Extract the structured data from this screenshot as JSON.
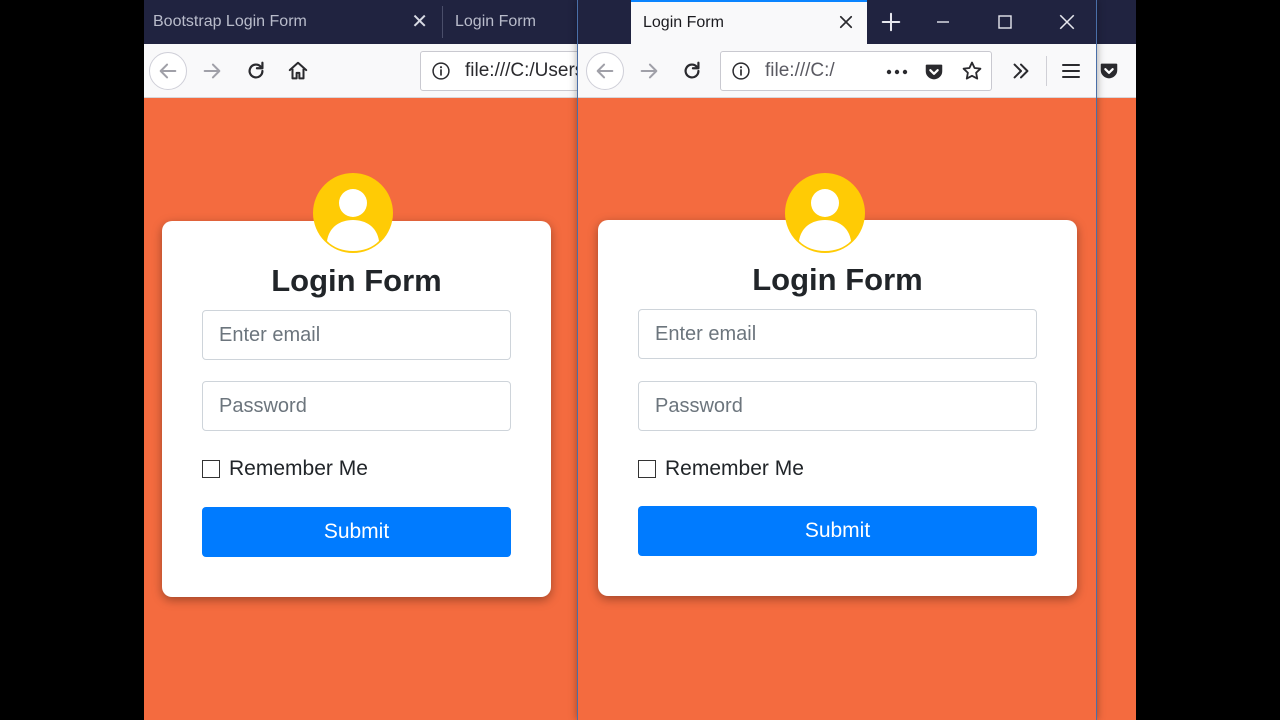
{
  "back_window": {
    "tabs": [
      {
        "label": "Bootstrap Login Form"
      },
      {
        "label": "Login Form"
      }
    ],
    "url": "file:///C:/Users/",
    "form": {
      "title": "Login Form",
      "email_placeholder": "Enter email",
      "password_placeholder": "Password",
      "remember_label": "Remember Me",
      "submit_label": "Submit"
    }
  },
  "front_window": {
    "tab_label": "Login Form",
    "url": "file:///C:/",
    "form": {
      "title": "Login Form",
      "email_placeholder": "Enter email",
      "password_placeholder": "Password",
      "remember_label": "Remember Me",
      "submit_label": "Submit"
    }
  },
  "colors": {
    "page_background": "#f46b3f",
    "tabbar": "#202340",
    "avatar": "#ffcb05",
    "submit_button": "#007bff"
  },
  "icons": {
    "back": "arrow-left-icon",
    "forward": "arrow-right-icon",
    "reload": "reload-icon",
    "home": "home-icon",
    "info": "info-icon",
    "more": "more-dots-icon",
    "pocket": "pocket-icon",
    "bookmark": "star-icon",
    "overflow": "double-chevron-icon",
    "menu": "hamburger-menu-icon",
    "new_tab": "plus-icon",
    "close": "close-icon",
    "minimize": "minimize-icon",
    "maximize": "maximize-icon",
    "user": "user-avatar-icon"
  }
}
